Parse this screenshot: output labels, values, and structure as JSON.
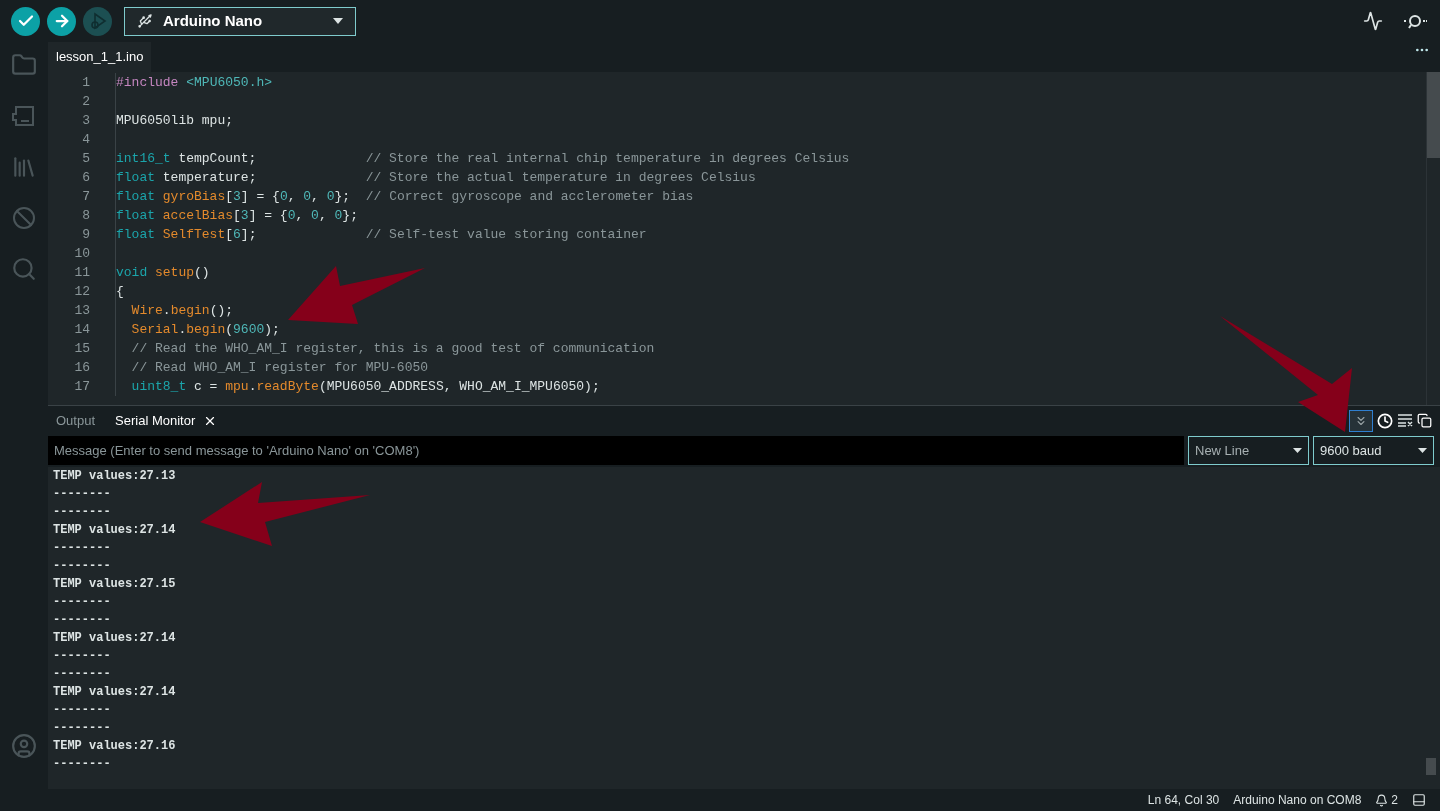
{
  "toolbar": {
    "debug_button": {
      "disabled": true
    },
    "board": "Arduino Nano"
  },
  "tabs": [
    {
      "label": "lesson_1_1.ino",
      "selected": true
    }
  ],
  "editor": {
    "lines": [
      {
        "number": "1",
        "tokens": [
          {
            "kind": "preproc",
            "text": "#include"
          },
          {
            "kind": "include",
            "text": " <MPU6050.h>"
          }
        ]
      },
      {
        "number": "2"
      },
      {
        "number": "3",
        "tokens": [
          {
            "kind": "plain",
            "text": "MPU6050lib mpu;"
          }
        ]
      },
      {
        "number": "4"
      },
      {
        "number": "5",
        "tokens": [
          {
            "kind": "type",
            "text": "int16_t"
          },
          {
            "kind": "plain",
            "text": " tempCount;              "
          },
          {
            "kind": "comment",
            "text": "// Store the real internal chip temperature in degrees Celsius"
          }
        ]
      },
      {
        "number": "6",
        "tokens": [
          {
            "kind": "type",
            "text": "float"
          },
          {
            "kind": "plain",
            "text": " temperature;              "
          },
          {
            "kind": "comment",
            "text": "// Store the actual temperature in degrees Celsius"
          }
        ]
      },
      {
        "number": "7",
        "tokens": [
          {
            "kind": "type",
            "text": "float"
          },
          {
            "kind": "func",
            "text": " gyroBias"
          },
          {
            "kind": "plain",
            "text": "["
          },
          {
            "kind": "number",
            "text": "3"
          },
          {
            "kind": "plain",
            "text": "] = {"
          },
          {
            "kind": "number",
            "text": "0"
          },
          {
            "kind": "plain",
            "text": ", "
          },
          {
            "kind": "number",
            "text": "0"
          },
          {
            "kind": "plain",
            "text": ", "
          },
          {
            "kind": "number",
            "text": "0"
          },
          {
            "kind": "plain",
            "text": "};  "
          },
          {
            "kind": "comment",
            "text": "// Correct gyroscope and acclerometer bias"
          }
        ]
      },
      {
        "number": "8",
        "tokens": [
          {
            "kind": "type",
            "text": "float"
          },
          {
            "kind": "func",
            "text": " accelBias"
          },
          {
            "kind": "plain",
            "text": "["
          },
          {
            "kind": "number",
            "text": "3"
          },
          {
            "kind": "plain",
            "text": "] = {"
          },
          {
            "kind": "number",
            "text": "0"
          },
          {
            "kind": "plain",
            "text": ", "
          },
          {
            "kind": "number",
            "text": "0"
          },
          {
            "kind": "plain",
            "text": ", "
          },
          {
            "kind": "number",
            "text": "0"
          },
          {
            "kind": "plain",
            "text": "};"
          }
        ]
      },
      {
        "number": "9",
        "tokens": [
          {
            "kind": "type",
            "text": "float"
          },
          {
            "kind": "func",
            "text": " SelfTest"
          },
          {
            "kind": "plain",
            "text": "["
          },
          {
            "kind": "number",
            "text": "6"
          },
          {
            "kind": "plain",
            "text": "];              "
          },
          {
            "kind": "comment",
            "text": "// Self-test value storing container"
          }
        ]
      },
      {
        "number": "10"
      },
      {
        "number": "11",
        "tokens": [
          {
            "kind": "type",
            "text": "void"
          },
          {
            "kind": "func",
            "text": " setup"
          },
          {
            "kind": "plain",
            "text": "()"
          }
        ]
      },
      {
        "number": "12",
        "tokens": [
          {
            "kind": "plain",
            "text": "{"
          }
        ]
      },
      {
        "number": "13",
        "tokens": [
          {
            "kind": "func",
            "text": "  Wire"
          },
          {
            "kind": "plain",
            "text": "."
          },
          {
            "kind": "func",
            "text": "begin"
          },
          {
            "kind": "plain",
            "text": "();"
          }
        ]
      },
      {
        "number": "14",
        "tokens": [
          {
            "kind": "func",
            "text": "  Serial"
          },
          {
            "kind": "plain",
            "text": "."
          },
          {
            "kind": "func",
            "text": "begin"
          },
          {
            "kind": "plain",
            "text": "("
          },
          {
            "kind": "number",
            "text": "9600"
          },
          {
            "kind": "plain",
            "text": ");"
          }
        ]
      },
      {
        "number": "15",
        "tokens": [
          {
            "kind": "comment",
            "text": "  // Read the WHO_AM_I register, this is a good test of communication"
          }
        ]
      },
      {
        "number": "16",
        "tokens": [
          {
            "kind": "comment",
            "text": "  // Read WHO_AM_I register for MPU-6050"
          }
        ]
      },
      {
        "number": "17",
        "tokens": [
          {
            "kind": "type",
            "text": "  uint8_t"
          },
          {
            "kind": "plain",
            "text": " c = "
          },
          {
            "kind": "func",
            "text": "mpu"
          },
          {
            "kind": "plain",
            "text": "."
          },
          {
            "kind": "func",
            "text": "readByte"
          },
          {
            "kind": "plain",
            "text": "(MPU6050_ADDRESS, WHO_AM_I_MPU6050);"
          }
        ]
      }
    ]
  },
  "panel": {
    "tabs": [
      {
        "label": "Output",
        "selected": false,
        "closable": false
      },
      {
        "label": "Serial Monitor",
        "selected": true,
        "closable": true
      }
    ],
    "autoscroll": {
      "on": true
    },
    "message_field": {
      "placeholder": "Message (Enter to send message to 'Arduino Nano' on 'COM8')"
    },
    "line_ending": "New Line",
    "baud_rate": "9600 baud",
    "output": [
      "TEMP values:27.13",
      "--------",
      "--------",
      "TEMP values:27.14",
      "--------",
      "--------",
      "TEMP values:27.15",
      "--------",
      "--------",
      "TEMP values:27.14",
      "--------",
      "--------",
      "TEMP values:27.14",
      "--------",
      "--------",
      "TEMP values:27.16",
      "--------"
    ]
  },
  "status_bar": {
    "position": "Ln 64, Col 30",
    "board_port": "Arduino Nano on COM8",
    "notifications": "2"
  }
}
